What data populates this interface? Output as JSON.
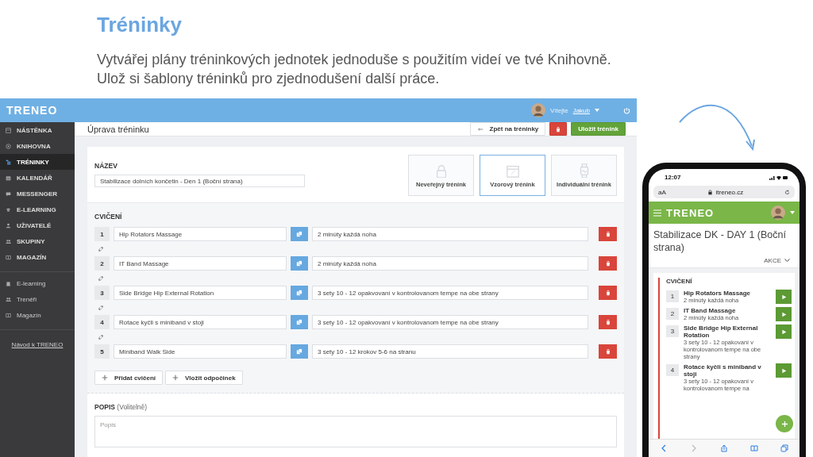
{
  "slide": {
    "title": "Tréninky",
    "subtitle": [
      "Vytvářej plány tréninkových jednotek jednoduše s použitím videí ve tvé Knihovně.",
      "Ulož si šablony tréninků pro zjednodušení další práce."
    ]
  },
  "app": {
    "logo": "TRENEO",
    "greeting": "Vítejte",
    "user": "Jakub",
    "sidebar": {
      "items": [
        {
          "label": "NÁSTĚNKA",
          "selected": false
        },
        {
          "label": "KNIHOVNA",
          "selected": false
        },
        {
          "label": "TRÉNINKY",
          "selected": true
        },
        {
          "label": "KALENDÁŘ",
          "selected": false
        },
        {
          "label": "MESSENGER",
          "selected": false
        },
        {
          "label": "E-LEARNING",
          "selected": false
        },
        {
          "label": "UŽIVATELÉ",
          "selected": false
        },
        {
          "label": "SKUPINY",
          "selected": false
        },
        {
          "label": "MAGAZÍN",
          "selected": false
        }
      ],
      "secondary": [
        "E-learning",
        "Trenéři",
        "Magazín"
      ],
      "guide_link": "Návod k TRENEO"
    },
    "page_title": "Úprava tréninku",
    "back_button": "Zpět na tréninky",
    "save_button": "Uložit trénink",
    "name_label": "NÁZEV",
    "name_value": "Stabilizace dolních končetin - Den 1 (Boční strana)",
    "types": [
      {
        "label": "Neveřejný trénink",
        "selected": false
      },
      {
        "label": "Vzorový trénink",
        "selected": true
      },
      {
        "label": "Individuální trénink",
        "selected": false
      }
    ],
    "exercises_label": "CVIČENÍ",
    "exercises": [
      {
        "number": "1",
        "name": "Hip Rotators Massage",
        "note": "2 minúty každá noha"
      },
      {
        "number": "2",
        "name": "IT Band Massage",
        "note": "2 minúty každá noha"
      },
      {
        "number": "3",
        "name": "Side Bridge Hip External Rotation",
        "note": "3 sety 10 - 12 opakvovaní v kontrolovanom tempe na obe strany"
      },
      {
        "number": "4",
        "name": "Rotace kyčli s miniband v stoji",
        "note": "3 sety 10 - 12 opakvovaní v kontrolovanom tempe na obe strany"
      },
      {
        "number": "5",
        "name": "Miniband Walk Side",
        "note": "3 sety 10 - 12  krokov 5-6 na stranu"
      }
    ],
    "add_exercise": "Přidat cvičení",
    "add_rest": "Vložit odpočinek",
    "description_label": "POPIS",
    "description_hint": "(Volitelně)",
    "description_placeholder": "Popis"
  },
  "phone": {
    "time": "12:07",
    "text_size": "aA",
    "url": "itreneo.cz",
    "logo": "TRENEO",
    "title": "Stabilizace DK - DAY 1 (Boční strana)",
    "actions": "AKCE",
    "section": "CVIČENÍ",
    "exercises": [
      {
        "number": "1",
        "name": "Hip Rotators Massage",
        "note": "2 minúty každá noha"
      },
      {
        "number": "2",
        "name": "IT Band Massage",
        "note": "2 minúty každá noha"
      },
      {
        "number": "3",
        "name": "Side Bridge Hip External Rotation",
        "note": "3 sety 10 - 12 opakovaní v kontrolovanom tempe na obe strany"
      },
      {
        "number": "4",
        "name": "Rotace kyčli s miniband v stoji",
        "note": "3 sety 10 - 12 opakovaní v kontrolovanom tempe na"
      }
    ]
  }
}
